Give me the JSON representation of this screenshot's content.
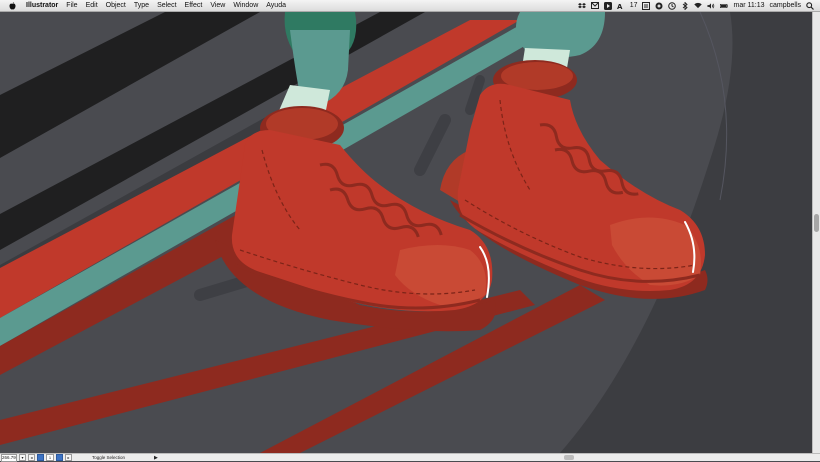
{
  "menubar": {
    "app_name": "Illustrator",
    "items": [
      "File",
      "Edit",
      "Object",
      "Type",
      "Select",
      "Effect",
      "View",
      "Window",
      "Ayuda"
    ],
    "status": {
      "font_size_indicator": "17",
      "clock": "mar 11:13",
      "user": "campbells"
    }
  },
  "statusbar": {
    "zoom": "266.79%",
    "page_number": "1",
    "tool_label": "Toggle Selection"
  },
  "colors": {
    "background": "#4a4b50",
    "boot_red": "#c0392b",
    "boot_dark": "#8e2a1f",
    "teal": "#5b9a90",
    "sock": "#cfe8da",
    "stripe_black": "#1f1f20"
  }
}
